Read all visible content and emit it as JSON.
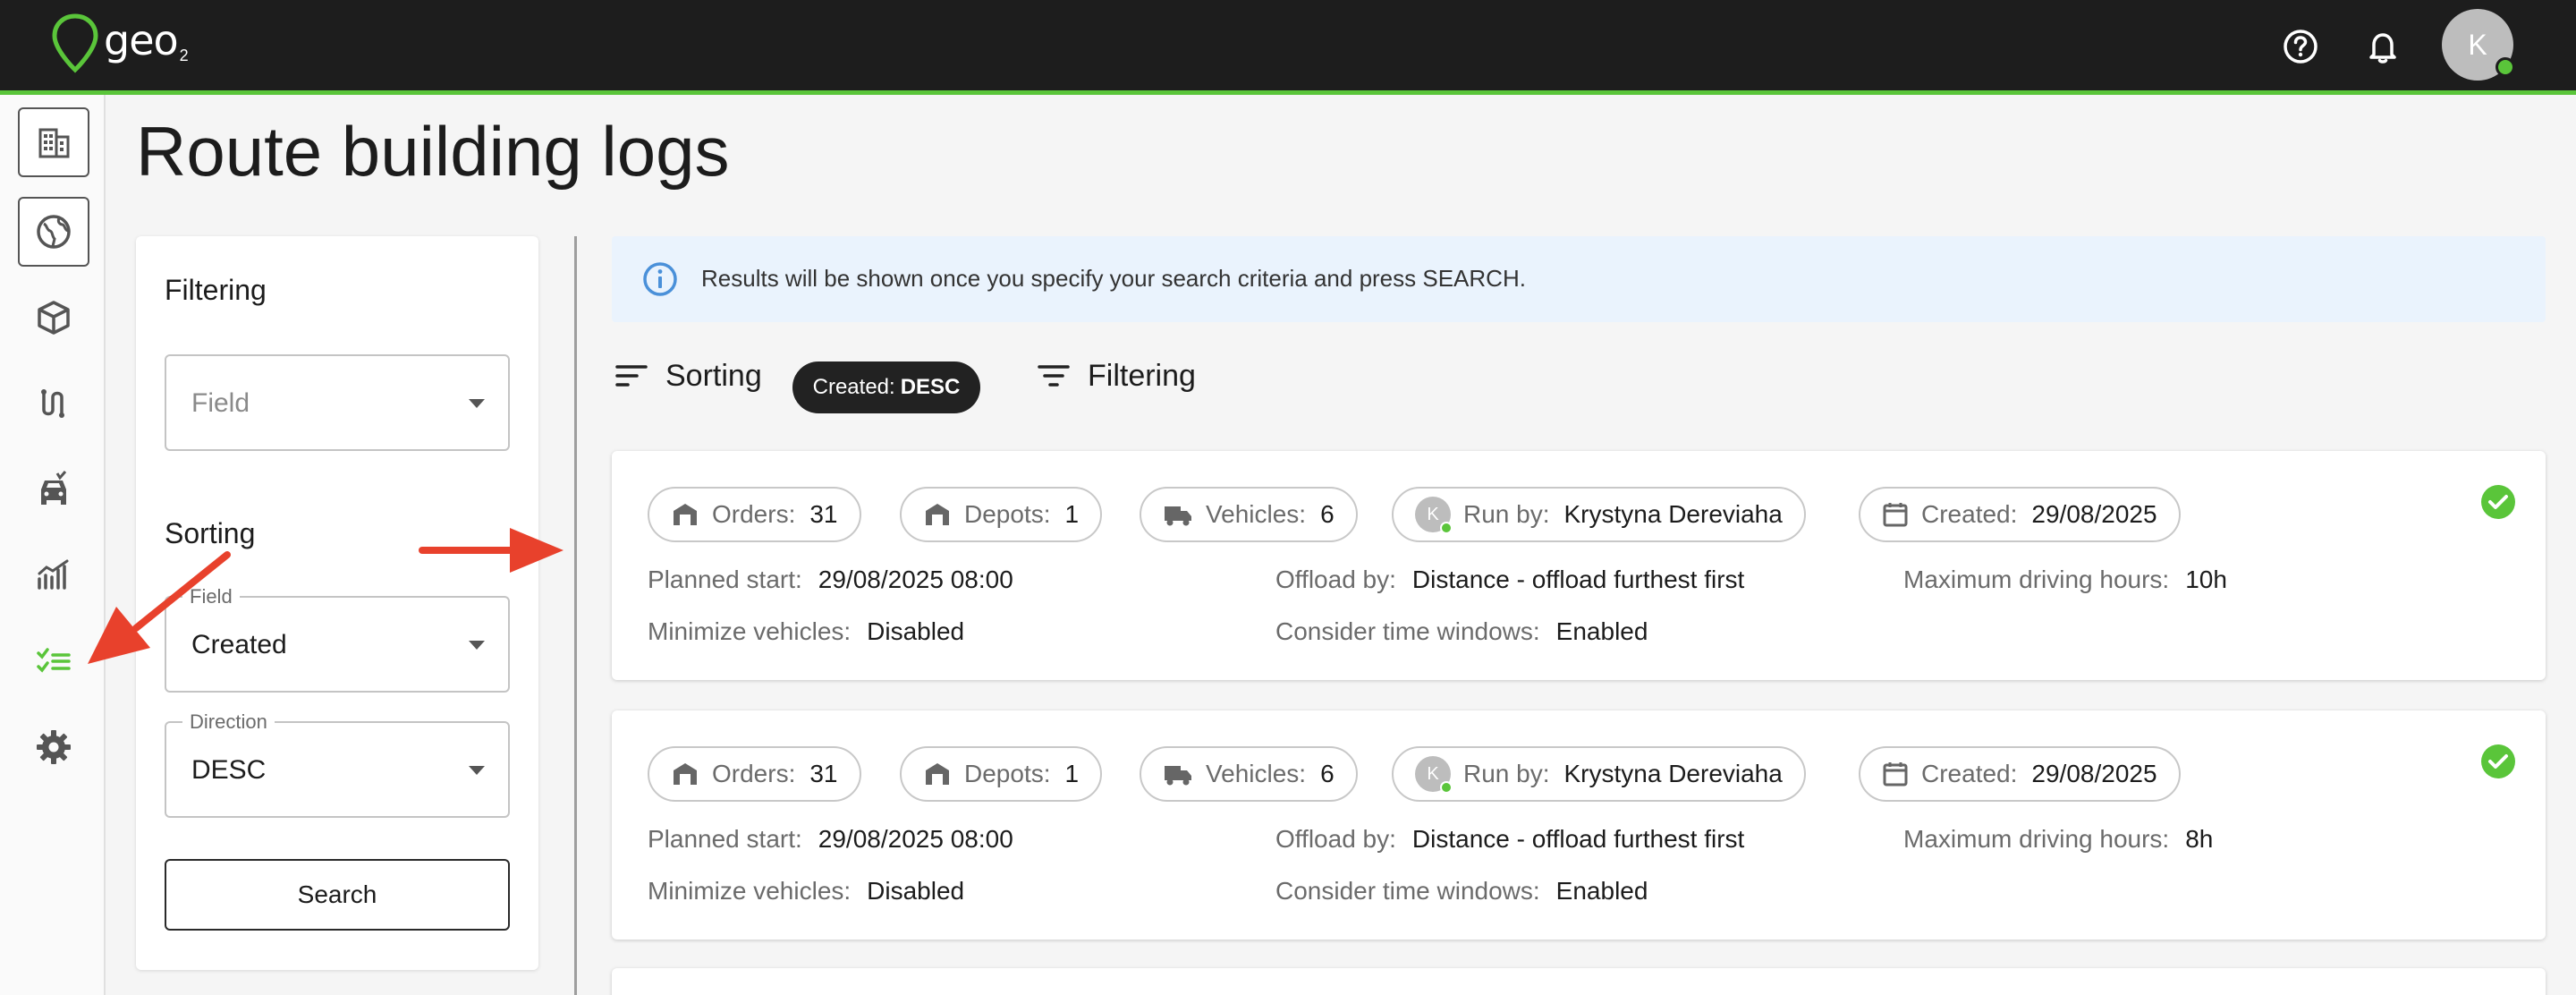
{
  "app": {
    "logo_text": "geo",
    "logo_sub": "2"
  },
  "header": {
    "avatar_initial": "K",
    "help_icon": "help-circle-icon",
    "bell_icon": "bell-icon"
  },
  "sidebar": {
    "items": [
      {
        "icon": "building-icon"
      },
      {
        "icon": "globe-icon"
      },
      {
        "icon": "package-icon"
      },
      {
        "icon": "route-icon"
      },
      {
        "icon": "vehicle-icon"
      },
      {
        "icon": "analytics-icon"
      },
      {
        "icon": "checklist-icon"
      },
      {
        "icon": "gear-icon"
      }
    ]
  },
  "page": {
    "title": "Route building logs"
  },
  "filter_panel": {
    "filtering_heading": "Filtering",
    "field_placeholder": "Field",
    "sorting_heading": "Sorting",
    "sort_field_label": "Field",
    "sort_field_value": "Created",
    "direction_label": "Direction",
    "direction_value": "DESC",
    "search_label": "Search"
  },
  "info": {
    "text": "Results will be shown once you specify your search criteria and press SEARCH."
  },
  "toolbar": {
    "sorting_label": "Sorting",
    "sort_chip_key": "Created:",
    "sort_chip_value": "DESC",
    "filtering_label": "Filtering"
  },
  "logs": [
    {
      "orders_label": "Orders:",
      "orders": "31",
      "depots_label": "Depots:",
      "depots": "1",
      "vehicles_label": "Vehicles:",
      "vehicles": "6",
      "run_by_label": "Run by:",
      "run_by_initial": "K",
      "run_by": "Krystyna Dereviaha",
      "created_label": "Created:",
      "created": "29/08/2025",
      "planned_start_label": "Planned start:",
      "planned_start": "29/08/2025 08:00",
      "offload_label": "Offload by:",
      "offload": "Distance - offload furthest first",
      "max_hours_label": "Maximum driving hours:",
      "max_hours": "10h",
      "minimize_label": "Minimize vehicles:",
      "minimize": "Disabled",
      "time_windows_label": "Consider time windows:",
      "time_windows": "Enabled"
    },
    {
      "orders_label": "Orders:",
      "orders": "31",
      "depots_label": "Depots:",
      "depots": "1",
      "vehicles_label": "Vehicles:",
      "vehicles": "6",
      "run_by_label": "Run by:",
      "run_by_initial": "K",
      "run_by": "Krystyna Dereviaha",
      "created_label": "Created:",
      "created": "29/08/2025",
      "planned_start_label": "Planned start:",
      "planned_start": "29/08/2025 08:00",
      "offload_label": "Offload by:",
      "offload": "Distance - offload furthest first",
      "max_hours_label": "Maximum driving hours:",
      "max_hours": "8h",
      "minimize_label": "Minimize vehicles:",
      "minimize": "Disabled",
      "time_windows_label": "Consider time windows:",
      "time_windows": "Enabled"
    }
  ],
  "colors": {
    "accent": "#5ac53a",
    "topbar": "#1d1d1d",
    "annotation_arrow": "#e8412c",
    "info_bg": "#eaf3fd",
    "info_icon": "#4a90d9"
  }
}
